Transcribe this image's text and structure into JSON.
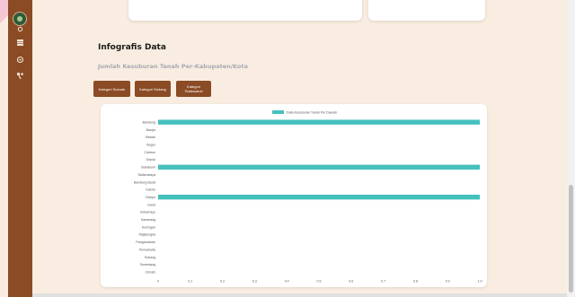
{
  "sidebar": {
    "logo": "logo-icon",
    "items": [
      {
        "icon": "home-icon"
      },
      {
        "icon": "table-icon"
      },
      {
        "icon": "map-pin-icon"
      },
      {
        "icon": "tools-icon"
      }
    ]
  },
  "section": {
    "title": "Infografis Data",
    "subtitle": "Jumlah Kesuburan Tanah Per-Kabupaten/Kota"
  },
  "buttons": {
    "subur": "Kategori Subuah",
    "sedang": "Kategori Sedang",
    "tidak_subur": "Kategori Tidaksubuh"
  },
  "colors": {
    "sidebar": "#8a4b25",
    "button": "#8a4b25",
    "bar": "#45c1bd",
    "page_bg": "#f8ede0"
  },
  "chart_data": {
    "type": "bar",
    "orientation": "horizontal",
    "categories": [
      "Bandung",
      "Banjar",
      "Bekasi",
      "Bogor",
      "Cirebon",
      "Depok",
      "Sukabumi",
      "Tasikmalaya",
      "Bandung Barat",
      "Ciamis",
      "Cianjur",
      "Garut",
      "Indramayu",
      "Karawang",
      "Kuningan",
      "Majalengka",
      "Pangandaran",
      "Purwakarta",
      "Subang",
      "Sumedang",
      "Cimahi"
    ],
    "series": [
      {
        "name": "Data Kesuburan Tanah Per Daerah",
        "values": [
          1,
          0,
          0,
          0,
          0,
          0,
          1,
          0,
          0,
          0,
          1,
          0,
          0,
          0,
          0,
          0,
          0,
          0,
          0,
          0,
          0
        ]
      }
    ],
    "x_ticks": [
      "0",
      "0.1",
      "0.2",
      "0.3",
      "0.4",
      "0.5",
      "0.6",
      "0.7",
      "0.8",
      "0.9",
      "1.0"
    ],
    "xlim": [
      0,
      1
    ],
    "legend_position": "top-center",
    "grid": false
  }
}
